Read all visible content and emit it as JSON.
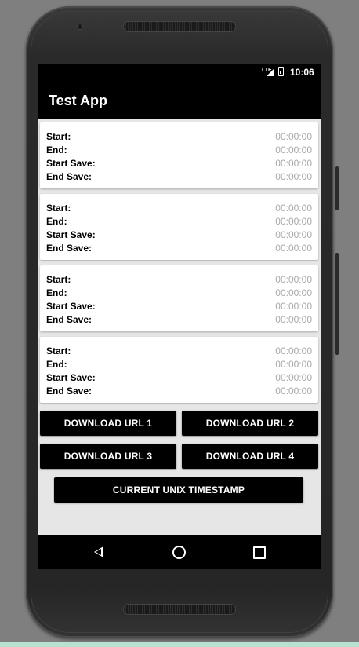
{
  "status_bar": {
    "network": "LTE",
    "time": "10:06"
  },
  "app": {
    "title": "Test App"
  },
  "cards": [
    {
      "rows": [
        {
          "label": "Start:",
          "value": "00:00:00"
        },
        {
          "label": "End:",
          "value": "00:00:00"
        },
        {
          "label": "Start Save:",
          "value": "00:00:00"
        },
        {
          "label": "End Save:",
          "value": "00:00:00"
        }
      ]
    },
    {
      "rows": [
        {
          "label": "Start:",
          "value": "00:00:00"
        },
        {
          "label": "End:",
          "value": "00:00:00"
        },
        {
          "label": "Start Save:",
          "value": "00:00:00"
        },
        {
          "label": "End Save:",
          "value": "00:00:00"
        }
      ]
    },
    {
      "rows": [
        {
          "label": "Start:",
          "value": "00:00:00"
        },
        {
          "label": "End:",
          "value": "00:00:00"
        },
        {
          "label": "Start Save:",
          "value": "00:00:00"
        },
        {
          "label": "End Save:",
          "value": "00:00:00"
        }
      ]
    },
    {
      "rows": [
        {
          "label": "Start:",
          "value": "00:00:00"
        },
        {
          "label": "End:",
          "value": "00:00:00"
        },
        {
          "label": "Start Save:",
          "value": "00:00:00"
        },
        {
          "label": "End Save:",
          "value": "00:00:00"
        }
      ]
    }
  ],
  "buttons": {
    "download_url_1": "DOWNLOAD URL 1",
    "download_url_2": "DOWNLOAD URL 2",
    "download_url_3": "DOWNLOAD URL 3",
    "download_url_4": "DOWNLOAD URL 4",
    "current_unix_timestamp": "CURRENT UNIX TIMESTAMP"
  },
  "nav_bar": {
    "icons": [
      "back-icon",
      "home-icon",
      "recent-apps-icon"
    ]
  },
  "colors": {
    "app_bar": "#000000",
    "screen_bg": "#e6e6e6",
    "value_text": "#a8a8a8",
    "button_bg": "#000000"
  }
}
